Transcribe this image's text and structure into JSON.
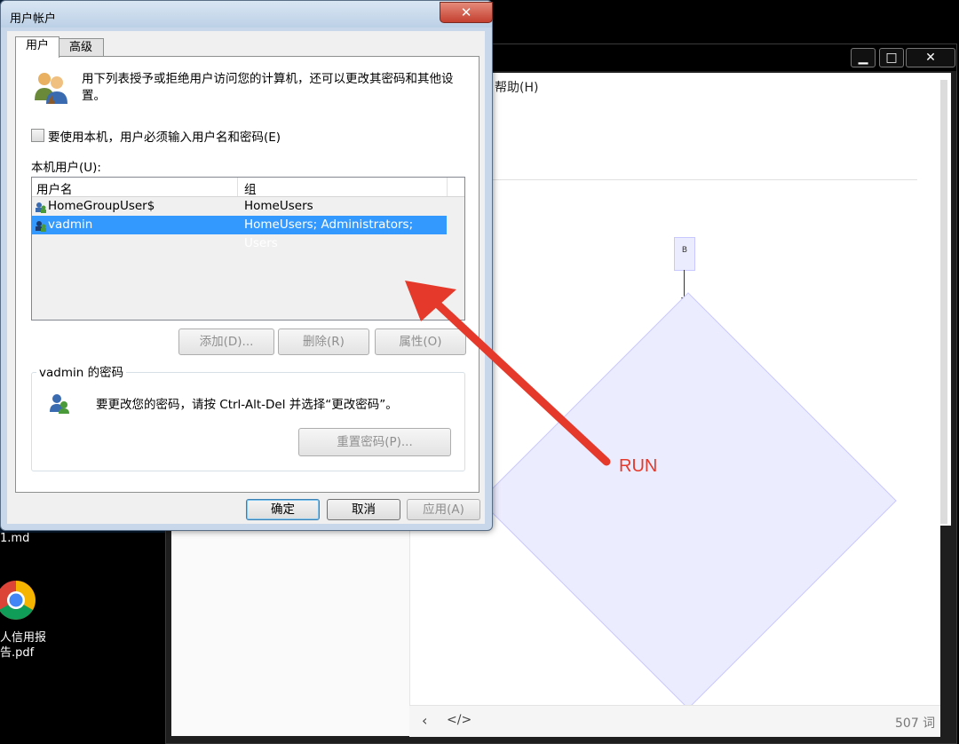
{
  "colors": {
    "annotation_red": "#e53a2b",
    "selection_blue": "#3399ff",
    "flow_fill": "#ececff"
  },
  "desktop": {
    "file_label": "1.md",
    "pdf_label_line1": "人信用报",
    "pdf_label_line2": "告.pdf",
    "chrome_icon": "chrome-icon"
  },
  "editor": {
    "menu_help": "帮助(H)",
    "window_buttons": {
      "minimize": "▁",
      "maximize": "□",
      "close": "✕"
    },
    "flow_node_label": "B",
    "footer": {
      "back": "‹",
      "code": "</>",
      "word_count": "507 词"
    }
  },
  "dialog": {
    "title": "用户帐户",
    "close_glyph": "✕",
    "tabs": [
      "用户",
      "高级"
    ],
    "intro": "用下列表授予或拒绝用户访问您的计算机，还可以更改其密码和其他设置。",
    "require_login_label": "要使用本机，用户必须输入用户名和密码(E)",
    "require_login_checked": false,
    "local_users_label": "本机用户(U):",
    "table": {
      "columns": [
        "用户名",
        "组"
      ],
      "rows": [
        {
          "name": "HomeGroupUser$",
          "group": "HomeUsers",
          "selected": false
        },
        {
          "name": "vadmin",
          "group": "HomeUsers; Administrators; Users",
          "selected": true
        }
      ]
    },
    "buttons": {
      "add": "添加(D)...",
      "delete": "删除(R)",
      "properties": "属性(O)"
    },
    "password_group": {
      "title": "vadmin 的密码",
      "text": "要更改您的密码，请按 Ctrl-Alt-Del 并选择“更改密码”。",
      "reset_button": "重置密码(P)..."
    },
    "footer_buttons": {
      "ok": "确定",
      "cancel": "取消",
      "apply": "应用(A)"
    }
  },
  "annotation": {
    "label": "RUN"
  }
}
